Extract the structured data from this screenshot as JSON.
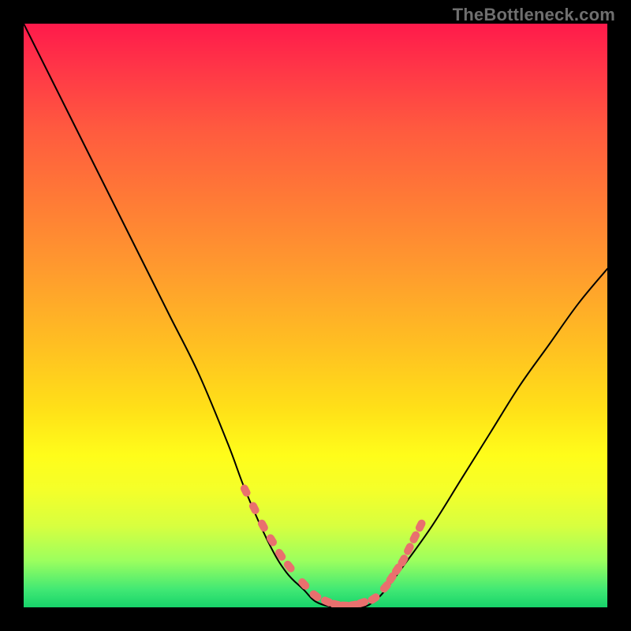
{
  "watermark": {
    "text": "TheBottleneck.com"
  },
  "colors": {
    "curve_stroke": "#000000",
    "marker_fill": "#e9706e",
    "marker_stroke": "#c74f4d"
  },
  "chart_data": {
    "type": "line",
    "title": "",
    "xlabel": "",
    "ylabel": "",
    "xlim": [
      0,
      100
    ],
    "ylim": [
      0,
      100
    ],
    "grid": false,
    "legend": false,
    "series": [
      {
        "name": "bottleneck-curve",
        "x": [
          0,
          5,
          10,
          15,
          20,
          25,
          30,
          35,
          38,
          42,
          45,
          48,
          50,
          53,
          55,
          58,
          60,
          62,
          65,
          70,
          75,
          80,
          85,
          90,
          95,
          100
        ],
        "y": [
          100,
          90,
          80,
          70,
          60,
          50,
          40,
          28,
          20,
          11,
          6,
          3,
          1,
          0,
          0,
          0,
          1,
          3,
          7,
          14,
          22,
          30,
          38,
          45,
          52,
          58
        ]
      }
    ],
    "markers": {
      "name": "highlight-points",
      "x": [
        38,
        39.5,
        41,
        42.5,
        44,
        45.5,
        48,
        50,
        52,
        53.5,
        55,
        56.5,
        58,
        60,
        62,
        63,
        64,
        65,
        66,
        67,
        68
      ],
      "y": [
        20,
        17,
        14,
        11.5,
        9,
        7,
        4,
        2,
        1,
        0.5,
        0.3,
        0.4,
        0.8,
        1.5,
        3.5,
        5,
        6.5,
        8,
        10,
        12,
        14
      ]
    }
  }
}
